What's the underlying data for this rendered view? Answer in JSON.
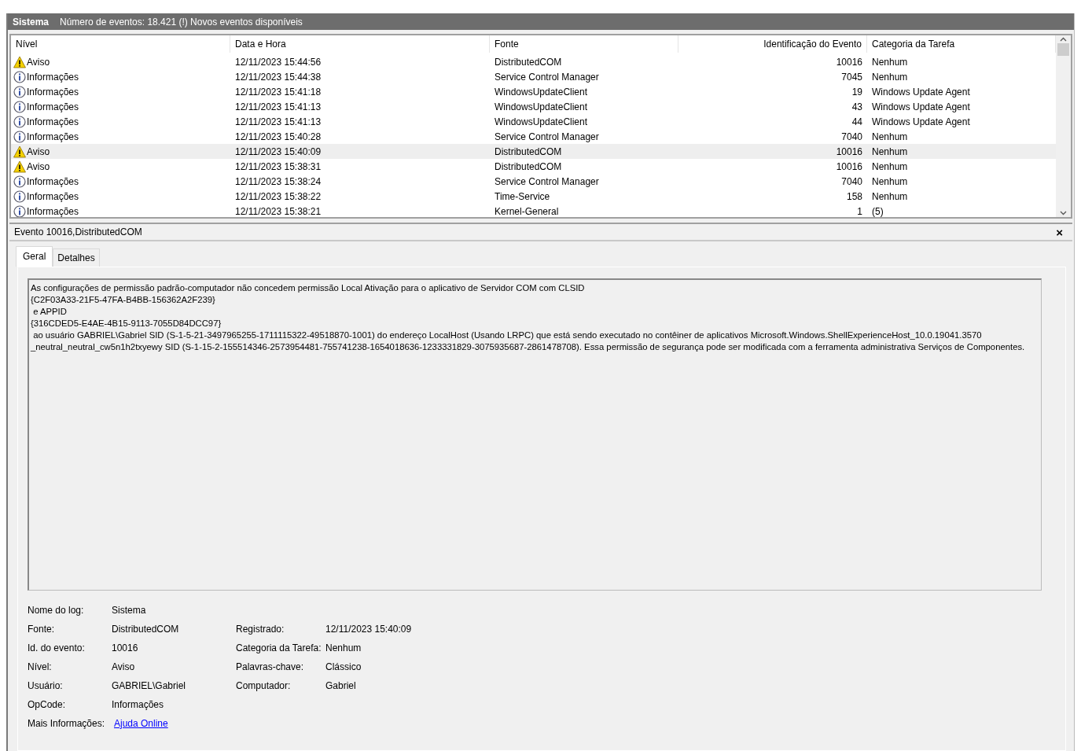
{
  "header": {
    "log_name": "Sistema",
    "summary": "Número de eventos: 18.421 (!) Novos eventos disponíveis"
  },
  "table": {
    "columns": [
      "Nível",
      "Data e Hora",
      "Fonte",
      "Identificação do Evento",
      "Categoria da Tarefa"
    ],
    "rows": [
      {
        "kind": "warning",
        "level": "Aviso",
        "date": "12/11/2023 15:44:56",
        "source": "DistributedCOM",
        "event_id": "10016",
        "category": "Nenhum",
        "selected": false
      },
      {
        "kind": "info",
        "level": "Informações",
        "date": "12/11/2023 15:44:38",
        "source": "Service Control Manager",
        "event_id": "7045",
        "category": "Nenhum",
        "selected": false
      },
      {
        "kind": "info",
        "level": "Informações",
        "date": "12/11/2023 15:41:18",
        "source": "WindowsUpdateClient",
        "event_id": "19",
        "category": "Windows Update Agent",
        "selected": false
      },
      {
        "kind": "info",
        "level": "Informações",
        "date": "12/11/2023 15:41:13",
        "source": "WindowsUpdateClient",
        "event_id": "43",
        "category": "Windows Update Agent",
        "selected": false
      },
      {
        "kind": "info",
        "level": "Informações",
        "date": "12/11/2023 15:41:13",
        "source": "WindowsUpdateClient",
        "event_id": "44",
        "category": "Windows Update Agent",
        "selected": false
      },
      {
        "kind": "info",
        "level": "Informações",
        "date": "12/11/2023 15:40:28",
        "source": "Service Control Manager",
        "event_id": "7040",
        "category": "Nenhum",
        "selected": false
      },
      {
        "kind": "warning",
        "level": "Aviso",
        "date": "12/11/2023 15:40:09",
        "source": "DistributedCOM",
        "event_id": "10016",
        "category": "Nenhum",
        "selected": true
      },
      {
        "kind": "warning",
        "level": "Aviso",
        "date": "12/11/2023 15:38:31",
        "source": "DistributedCOM",
        "event_id": "10016",
        "category": "Nenhum",
        "selected": false
      },
      {
        "kind": "info",
        "level": "Informações",
        "date": "12/11/2023 15:38:24",
        "source": "Service Control Manager",
        "event_id": "7040",
        "category": "Nenhum",
        "selected": false
      },
      {
        "kind": "info",
        "level": "Informações",
        "date": "12/11/2023 15:38:22",
        "source": "Time-Service",
        "event_id": "158",
        "category": "Nenhum",
        "selected": false
      },
      {
        "kind": "info",
        "level": "Informações",
        "date": "12/11/2023 15:38:21",
        "source": "Kernel-General",
        "event_id": "1",
        "category": "(5)",
        "selected": false
      }
    ]
  },
  "details": {
    "title": "Evento 10016,DistributedCOM",
    "close": "×",
    "tabs": [
      {
        "label": "Geral",
        "selected": true
      },
      {
        "label": "Detalhes",
        "selected": false
      }
    ],
    "message_lines": [
      "As configurações de permissão padrão-computador não concedem permissão Local Ativação para o aplicativo de Servidor COM com CLSID",
      "{C2F03A33-21F5-47FA-B4BB-156362A2F239}",
      " e APPID",
      "{316CDED5-E4AE-4B15-9113-7055D84DCC97}",
      " ao usuário GABRIEL\\Gabriel SID (S-1-5-21-3497965255-1711115322-49518870-1001) do endereço LocalHost (Usando LRPC) que está sendo executado no contêiner de aplicativos Microsoft.Windows.ShellExperienceHost_10.0.19041.3570",
      "_neutral_neutral_cw5n1h2txyewy SID (S-1-15-2-155514346-2573954481-755741238-1654018636-1233331829-3075935687-2861478708). Essa permissão de segurança pode ser modificada com a ferramenta administrativa Serviços de Componentes."
    ],
    "properties": [
      [
        {
          "label": "Nome do log:",
          "value": "Sistema"
        }
      ],
      [
        {
          "label": "Fonte:",
          "value": "DistributedCOM"
        },
        {
          "label": "Registrado:",
          "value": "12/11/2023 15:40:09"
        }
      ],
      [
        {
          "label": "Id. do evento:",
          "value": "10016"
        },
        {
          "label": "Categoria da Tarefa:",
          "value": "Nenhum"
        }
      ],
      [
        {
          "label": "Nível:",
          "value": "Aviso"
        },
        {
          "label": "Palavras-chave:",
          "value": "Clássico"
        }
      ],
      [
        {
          "label": "Usuário:",
          "value": "GABRIEL\\Gabriel"
        },
        {
          "label": "Computador:",
          "value": "Gabriel"
        }
      ],
      [
        {
          "label": "OpCode:",
          "value": "Informações"
        }
      ],
      [
        {
          "label": "Mais Informações:",
          "value": "Ajuda Online",
          "kind": "link"
        }
      ]
    ]
  }
}
